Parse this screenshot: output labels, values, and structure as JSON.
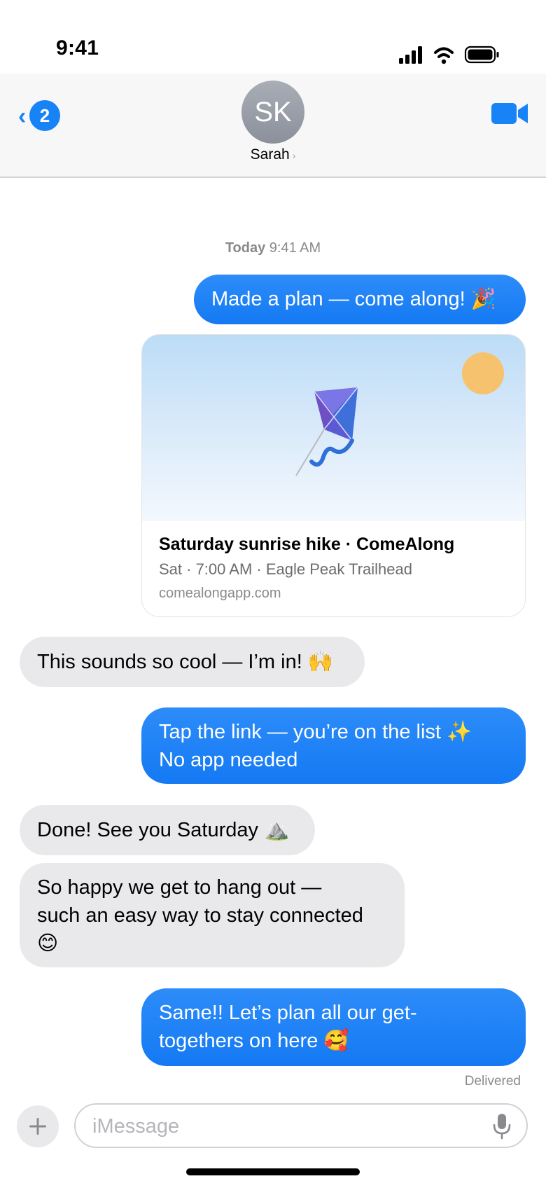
{
  "status_bar": {
    "time": "9:41",
    "signal_icon": "cellular-signal-icon",
    "wifi_icon": "wifi-icon",
    "battery_icon": "battery-icon"
  },
  "header": {
    "back_badge": "2",
    "avatar_initials": "SK",
    "contact_name": "Sarah",
    "contact_chevron": "›",
    "video_icon": "video-camera-icon"
  },
  "conversation": {
    "timestamp_day": "Today",
    "timestamp_time": "9:41 AM",
    "messages": [
      {
        "direction": "outgoing",
        "lines": [
          "Made a plan — come along! 🎉"
        ]
      },
      {
        "direction": "incoming",
        "lines": [
          "This sounds so cool — I’m in! 🙌"
        ]
      },
      {
        "direction": "outgoing",
        "lines": [
          "Tap the link — you’re on the list ✨",
          "No app needed"
        ]
      },
      {
        "direction": "incoming",
        "lines": [
          "Done! See you Saturday ⛰️"
        ]
      },
      {
        "direction": "incoming",
        "lines": [
          "So happy we get to hang out —",
          "such an easy way to stay connected",
          "😊"
        ]
      },
      {
        "direction": "outgoing",
        "lines": [
          "Same!! Let’s plan all our get-",
          "togethers on here 🥰"
        ]
      }
    ],
    "link_preview": {
      "title": "Saturday sunrise hike · ComeAlong",
      "subtitle": "Sat · 7:00 AM · Eagle Peak Trailhead",
      "domain": "comealongapp.com",
      "image_icon": "kite-icon"
    },
    "delivered_label": "Delivered"
  },
  "composer": {
    "placeholder": "iMessage",
    "value": "",
    "plus_icon": "plus-icon",
    "mic_icon": "microphone-icon"
  },
  "colors": {
    "accent": "#1882f7",
    "outgoing_bubble": "#1a7ff5",
    "incoming_bubble": "#e9e9eb"
  }
}
